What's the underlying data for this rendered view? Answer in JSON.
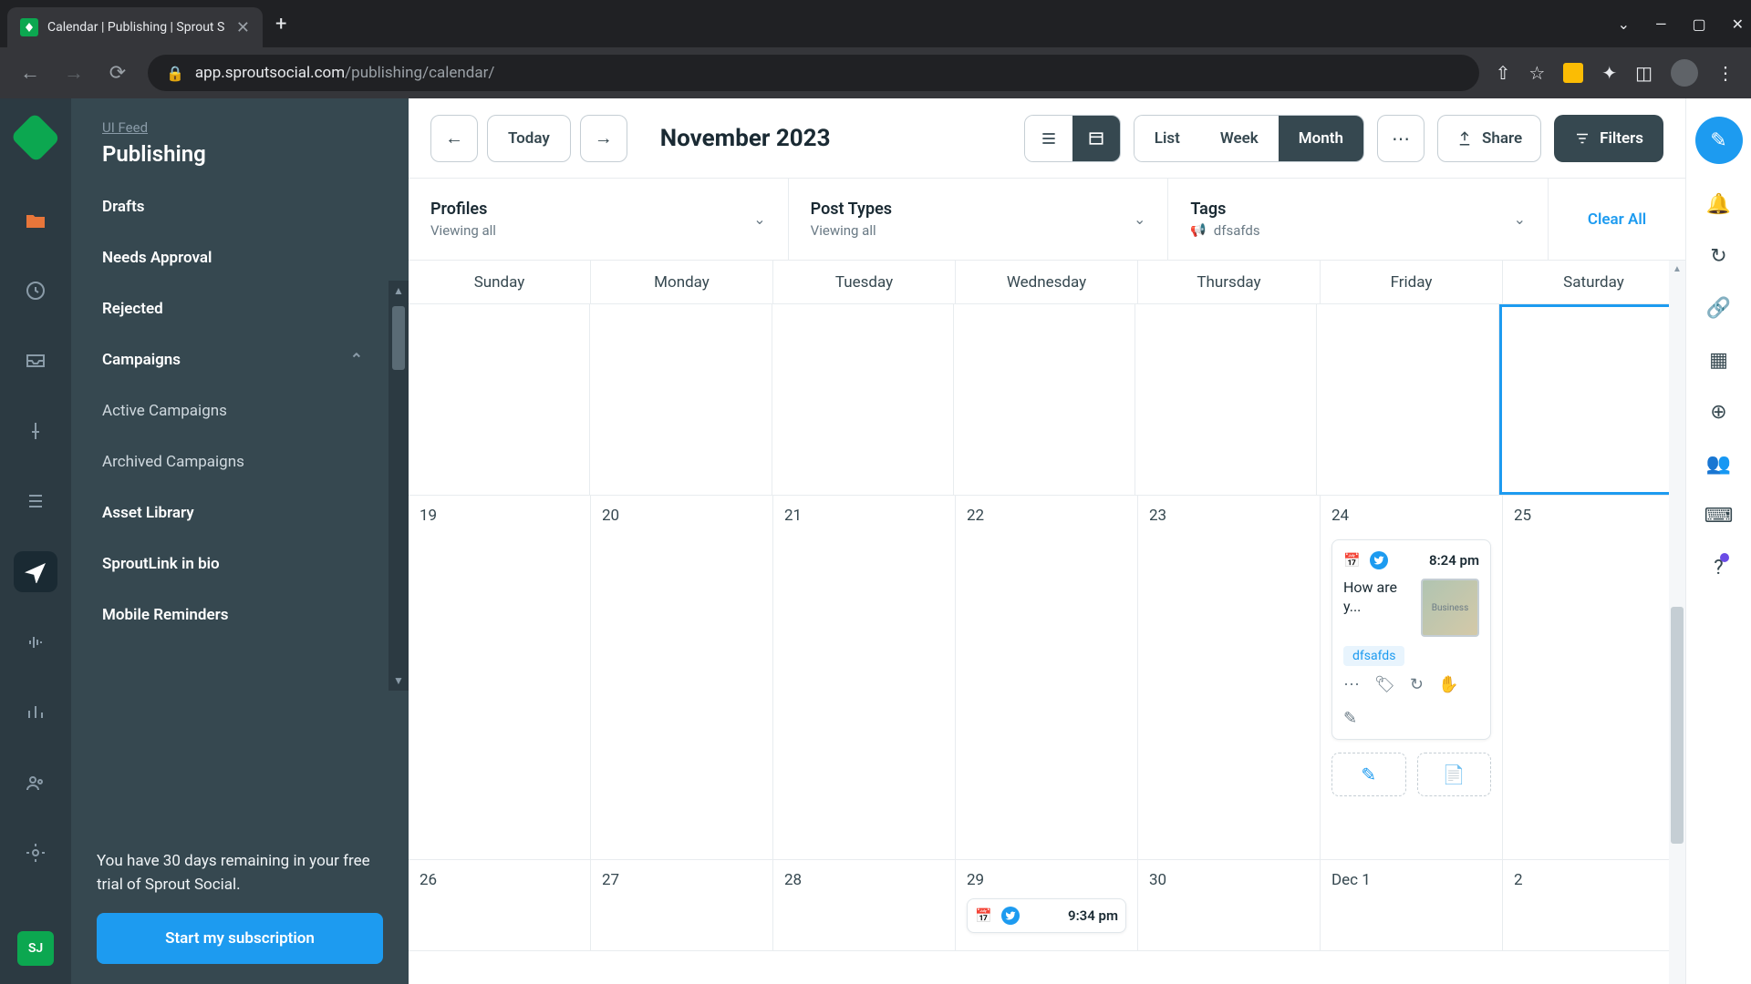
{
  "browser": {
    "tab_title": "Calendar | Publishing | Sprout S",
    "url_domain": "app.sproutsocial.com",
    "url_path": "/publishing/calendar/"
  },
  "sidebar": {
    "breadcrumb": "UI Feed",
    "title": "Publishing",
    "items": [
      {
        "label": "Drafts"
      },
      {
        "label": "Needs Approval"
      },
      {
        "label": "Rejected"
      },
      {
        "label": "Campaigns",
        "expandable": true
      },
      {
        "label": "Active Campaigns",
        "sub": true
      },
      {
        "label": "Archived Campaigns",
        "sub": true
      },
      {
        "label": "Asset Library"
      },
      {
        "label": "SproutLink in bio"
      },
      {
        "label": "Mobile Reminders"
      }
    ],
    "trial_text": "You have 30 days remaining in your free trial of Sprout Social.",
    "subscribe": "Start my subscription",
    "avatar_initials": "SJ"
  },
  "toolbar": {
    "today": "Today",
    "month_title": "November 2023",
    "periods": {
      "list": "List",
      "week": "Week",
      "month": "Month"
    },
    "share": "Share",
    "filters": "Filters"
  },
  "filters": {
    "profiles_label": "Profiles",
    "profiles_value": "Viewing all",
    "post_types_label": "Post Types",
    "post_types_value": "Viewing all",
    "tags_label": "Tags",
    "tags_value": "dfsafds",
    "clear": "Clear All"
  },
  "calendar": {
    "days": [
      "Sunday",
      "Monday",
      "Tuesday",
      "Wednesday",
      "Thursday",
      "Friday",
      "Saturday"
    ],
    "row1": [
      "",
      "",
      "",
      "",
      "",
      "",
      ""
    ],
    "row2": [
      "19",
      "20",
      "21",
      "22",
      "23",
      "24",
      "25"
    ],
    "row3": [
      "26",
      "27",
      "28",
      "29",
      "30",
      "Dec 1",
      "2"
    ]
  },
  "post": {
    "time": "8:24 pm",
    "text": "How are y...",
    "tag": "dfsafds",
    "thumb_label": "Business"
  },
  "post2": {
    "time": "9:34 pm"
  }
}
